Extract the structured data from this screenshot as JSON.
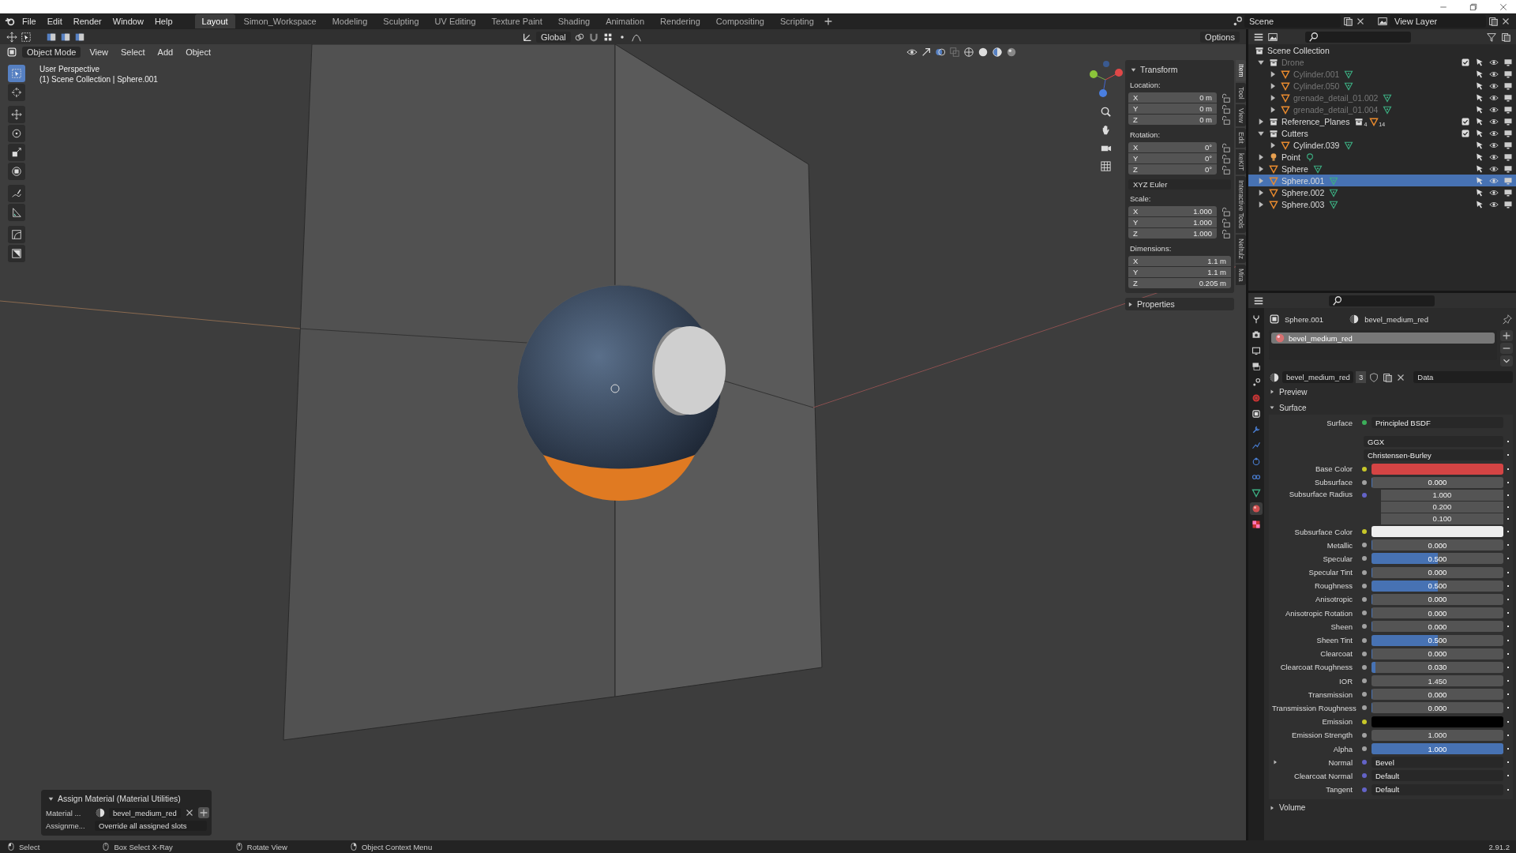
{
  "menu": [
    "File",
    "Edit",
    "Render",
    "Window",
    "Help"
  ],
  "workspaces": [
    {
      "label": "Layout",
      "selected": true
    },
    {
      "label": "Simon_Workspace",
      "selected": false
    },
    {
      "label": "Modeling",
      "selected": false
    },
    {
      "label": "Sculpting",
      "selected": false
    },
    {
      "label": "UV Editing",
      "selected": false
    },
    {
      "label": "Texture Paint",
      "selected": false
    },
    {
      "label": "Shading",
      "selected": false
    },
    {
      "label": "Animation",
      "selected": false
    },
    {
      "label": "Rendering",
      "selected": false
    },
    {
      "label": "Compositing",
      "selected": false
    },
    {
      "label": "Scripting",
      "selected": false
    }
  ],
  "scene": "Scene",
  "view_layer": "View Layer",
  "tool_settings": {
    "orientation": "Global",
    "options": "Options"
  },
  "viewport": {
    "mode": "Object Mode",
    "menus": [
      "View",
      "Select",
      "Add",
      "Object"
    ],
    "overlay_text": [
      "User Perspective",
      "(1) Scene Collection | Sphere.001"
    ],
    "tools": [
      {
        "kind": "select",
        "selected": true
      },
      {
        "kind": "cursor",
        "selected": false
      },
      {
        "kind": "move",
        "selected": false
      },
      {
        "kind": "rotate",
        "selected": false
      },
      {
        "kind": "scale",
        "selected": false
      },
      {
        "kind": "transform",
        "selected": false
      },
      {
        "kind": "annotate",
        "selected": false
      },
      {
        "kind": "measure",
        "selected": false
      },
      {
        "kind": "curve",
        "selected": false
      },
      {
        "kind": "bevel",
        "selected": false
      }
    ],
    "operator_panel": {
      "title": "Assign Material (Material Utilities)",
      "fields": [
        {
          "label": "Material ...",
          "value": "bevel_medium_red",
          "kind": "material"
        },
        {
          "label": "Assignme...",
          "value": "Override all assigned slots",
          "kind": "dropdown"
        }
      ]
    }
  },
  "sidebar": {
    "title": "Transform",
    "groups": [
      {
        "label": "Location:",
        "rows": [
          {
            "axis": "X",
            "value": "0 m"
          },
          {
            "axis": "Y",
            "value": "0 m"
          },
          {
            "axis": "Z",
            "value": "0 m"
          }
        ],
        "locks": true
      },
      {
        "label": "Rotation:",
        "rows": [
          {
            "axis": "X",
            "value": "0°"
          },
          {
            "axis": "Y",
            "value": "0°"
          },
          {
            "axis": "Z",
            "value": "0°"
          }
        ],
        "locks": true,
        "mode": "XYZ Euler"
      },
      {
        "label": "Scale:",
        "rows": [
          {
            "axis": "X",
            "value": "1.000"
          },
          {
            "axis": "Y",
            "value": "1.000"
          },
          {
            "axis": "Z",
            "value": "1.000"
          }
        ],
        "locks": true
      },
      {
        "label": "Dimensions:",
        "rows": [
          {
            "axis": "X",
            "value": "1.1 m"
          },
          {
            "axis": "Y",
            "value": "1.1 m"
          },
          {
            "axis": "Z",
            "value": "0.205 m"
          }
        ],
        "locks": false
      }
    ],
    "collapsed_panel": "Properties",
    "tabs": [
      {
        "label": "Item",
        "selected": true
      },
      {
        "label": "Tool",
        "selected": false
      },
      {
        "label": "View",
        "selected": false
      },
      {
        "label": "Edit",
        "selected": false
      },
      {
        "label": "keKIT",
        "selected": false
      },
      {
        "label": "Interactive Tools",
        "selected": false
      },
      {
        "label": "Neltulz",
        "selected": false
      },
      {
        "label": "Mira",
        "selected": false
      }
    ]
  },
  "outliner": {
    "root": "Scene Collection",
    "items": [
      {
        "name": "Drone",
        "kind": "collection",
        "expanded": true,
        "checked": true,
        "disabled": true,
        "selected": false,
        "children": [
          {
            "name": "Cylinder.001",
            "kind": "mesh",
            "expanded": false,
            "disabled": true,
            "selected": false
          },
          {
            "name": "Cylinder.050",
            "kind": "mesh",
            "expanded": false,
            "disabled": true,
            "selected": false
          },
          {
            "name": "grenade_detail_01.002",
            "kind": "mesh",
            "expanded": false,
            "disabled": true,
            "selected": false
          },
          {
            "name": "grenade_detail_01.004",
            "kind": "mesh",
            "expanded": false,
            "disabled": true,
            "selected": false
          }
        ]
      },
      {
        "name": "Reference_Planes",
        "kind": "collection",
        "expanded": false,
        "checked": true,
        "disabled": false,
        "selected": false,
        "counts": [
          "4",
          "14"
        ]
      },
      {
        "name": "Cutters",
        "kind": "collection",
        "expanded": true,
        "checked": true,
        "disabled": false,
        "selected": false,
        "children": [
          {
            "name": "Cylinder.039",
            "kind": "mesh",
            "expanded": false,
            "disabled": false,
            "selected": false
          }
        ]
      },
      {
        "name": "Point",
        "kind": "light",
        "expanded": false,
        "disabled": false,
        "selected": false
      },
      {
        "name": "Sphere",
        "kind": "mesh",
        "expanded": false,
        "disabled": false,
        "selected": false
      },
      {
        "name": "Sphere.001",
        "kind": "mesh",
        "expanded": false,
        "disabled": false,
        "selected": true
      },
      {
        "name": "Sphere.002",
        "kind": "mesh",
        "expanded": false,
        "disabled": false,
        "selected": false
      },
      {
        "name": "Sphere.003",
        "kind": "mesh",
        "expanded": false,
        "disabled": false,
        "selected": false
      }
    ]
  },
  "properties": {
    "object": "Sphere.001",
    "material": "bevel_medium_red",
    "tabs": [
      {
        "kind": "tool",
        "selected": false
      },
      {
        "kind": "render",
        "selected": false
      },
      {
        "kind": "output",
        "selected": false
      },
      {
        "kind": "view_layer",
        "selected": false
      },
      {
        "kind": "scene",
        "selected": false
      },
      {
        "kind": "world",
        "selected": false
      },
      {
        "kind": "object",
        "selected": false
      },
      {
        "kind": "modifier",
        "selected": false
      },
      {
        "kind": "particles",
        "selected": false
      },
      {
        "kind": "physics",
        "selected": false
      },
      {
        "kind": "constraint",
        "selected": false
      },
      {
        "kind": "data",
        "selected": false
      },
      {
        "kind": "material",
        "selected": true
      },
      {
        "kind": "texture",
        "selected": false
      }
    ],
    "slots": [
      {
        "name": "bevel_medium_red",
        "selected": true
      }
    ],
    "datablock": {
      "name": "bevel_medium_red",
      "users": "3",
      "link": "Data"
    },
    "panels": [
      {
        "title": "Preview",
        "expanded": false
      },
      {
        "title": "Surface",
        "expanded": true
      }
    ],
    "surface": {
      "label": "Surface",
      "shader": "Principled BSDF",
      "dropdowns": [
        "GGX",
        "Christensen-Burley"
      ]
    },
    "inputs": [
      {
        "label": "Base Color",
        "kind": "color",
        "color": "#d44444"
      },
      {
        "label": "Subsurface",
        "kind": "slider",
        "value": "0.000",
        "level": 0
      },
      {
        "label": "Subsurface Radius",
        "kind": "vector",
        "values": [
          "1.000",
          "0.200",
          "0.100"
        ]
      },
      {
        "label": "Subsurface Color",
        "kind": "color",
        "color": "#eeeeee"
      },
      {
        "label": "Metallic",
        "kind": "slider",
        "value": "0.000",
        "level": 0
      },
      {
        "label": "Specular",
        "kind": "slider",
        "value": "0.500",
        "level": 0.5
      },
      {
        "label": "Specular Tint",
        "kind": "slider",
        "value": "0.000",
        "level": 0
      },
      {
        "label": "Roughness",
        "kind": "slider",
        "value": "0.500",
        "level": 0.5
      },
      {
        "label": "Anisotropic",
        "kind": "slider",
        "value": "0.000",
        "level": 0
      },
      {
        "label": "Anisotropic Rotation",
        "kind": "slider",
        "value": "0.000",
        "level": 0
      },
      {
        "label": "Sheen",
        "kind": "slider",
        "value": "0.000",
        "level": 0
      },
      {
        "label": "Sheen Tint",
        "kind": "slider",
        "value": "0.500",
        "level": 0.5
      },
      {
        "label": "Clearcoat",
        "kind": "slider",
        "value": "0.000",
        "level": 0
      },
      {
        "label": "Clearcoat Roughness",
        "kind": "slider",
        "value": "0.030",
        "level": 0.03
      },
      {
        "label": "IOR",
        "kind": "number",
        "value": "1.450"
      },
      {
        "label": "Transmission",
        "kind": "slider",
        "value": "0.000",
        "level": 0
      },
      {
        "label": "Transmission Roughness",
        "kind": "slider",
        "value": "0.000",
        "level": 0
      },
      {
        "label": "Emission",
        "kind": "color",
        "color": "#000000"
      },
      {
        "label": "Emission Strength",
        "kind": "number",
        "value": "1.000"
      },
      {
        "label": "Alpha",
        "kind": "slider",
        "value": "1.000",
        "level": 1
      },
      {
        "label": "Normal",
        "kind": "link",
        "value": "Bevel",
        "expandable": true
      },
      {
        "label": "Clearcoat Normal",
        "kind": "link",
        "value": "Default",
        "expandable": false
      },
      {
        "label": "Tangent",
        "kind": "link",
        "value": "Default",
        "expandable": false
      }
    ],
    "closed_panel": "Volume"
  },
  "status_bar": {
    "items": [
      {
        "label": "Select",
        "kind": "left"
      },
      {
        "label": "Box Select X-Ray",
        "kind": "drag"
      },
      {
        "label": "Rotate View",
        "kind": "middle"
      },
      {
        "label": "Object Context Menu",
        "kind": "right"
      }
    ],
    "version": "2.91.2"
  }
}
